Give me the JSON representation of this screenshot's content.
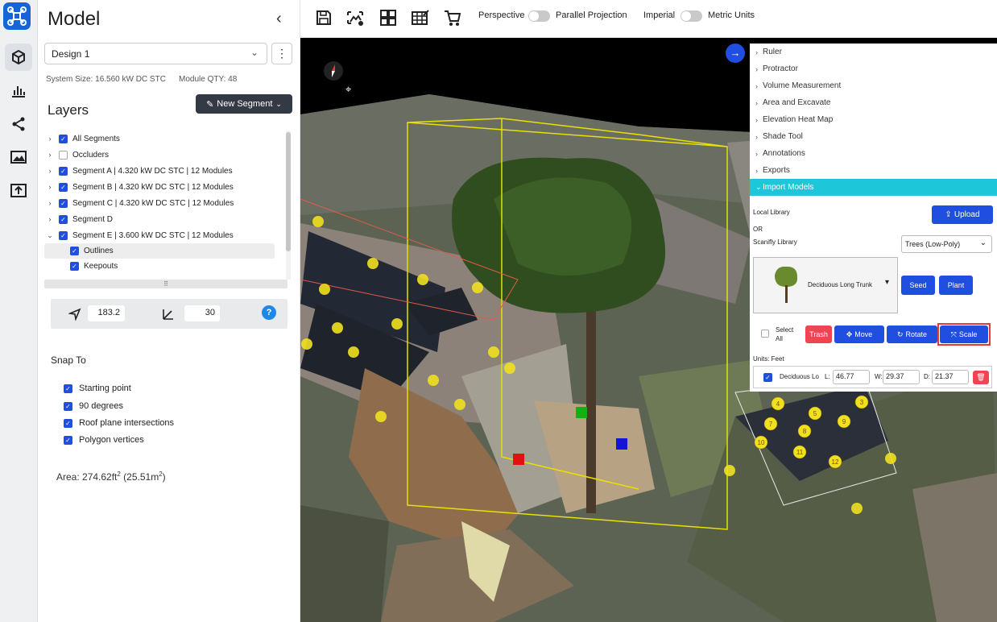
{
  "app": {
    "accent": "#1f4ee0",
    "cyan": "#1dc6d9",
    "danger": "#ef4451"
  },
  "rail": {
    "icons": [
      "logo-icon",
      "cube-icon",
      "chart-icon",
      "share-icon",
      "image-icon",
      "upload-icon"
    ]
  },
  "panel": {
    "title": "Model",
    "design_select": "Design 1",
    "system_size": "System Size: 16.560 kW DC STC",
    "module_qty": "Module QTY: 48",
    "layers_title": "Layers",
    "new_segment": "New Segment",
    "tree": [
      {
        "label": "All Segments",
        "checked": true,
        "arrow": "›"
      },
      {
        "label": "Occluders",
        "checked": false,
        "arrow": "›"
      },
      {
        "label": "Segment A | 4.320 kW DC STC | 12 Modules",
        "checked": true,
        "arrow": "›"
      },
      {
        "label": "Segment B | 4.320 kW DC STC | 12 Modules",
        "checked": true,
        "arrow": "›"
      },
      {
        "label": "Segment C | 4.320 kW DC STC | 12 Modules",
        "checked": true,
        "arrow": "›"
      },
      {
        "label": "Segment D",
        "checked": true,
        "arrow": "›"
      },
      {
        "label": "Segment E | 3.600 kW DC STC | 12 Modules",
        "checked": true,
        "arrow": "⌄"
      }
    ],
    "subitems": [
      {
        "label": "Outlines",
        "checked": true
      },
      {
        "label": "Keepouts",
        "checked": true
      }
    ],
    "azimuth": "183.2",
    "pitch": "30",
    "help": "?",
    "snap_title": "Snap To",
    "snap": [
      "Starting point",
      "90 degrees",
      "Roof plane intersections",
      "Polygon vertices"
    ],
    "area": {
      "prefix": "Area: 274.62ft",
      "sup1": "2",
      "mid": " (25.51m",
      "sup2": "2",
      "suffix": ")"
    }
  },
  "toolbar": {
    "icons": [
      "save-icon",
      "image-edit-icon",
      "grid-layout-icon",
      "table-edit-icon",
      "cart-icon"
    ],
    "perspective": "Perspective",
    "parallel": "Parallel Projection",
    "imperial": "Imperial",
    "metric": "Metric Units"
  },
  "tools": {
    "items": [
      "Ruler",
      "Protractor",
      "Volume Measurement",
      "Area and Excavate",
      "Elevation Heat Map",
      "Shade Tool",
      "Annotations",
      "Exports",
      "Import Models"
    ],
    "local_library": "Local Library",
    "upload": "Upload",
    "or": "OR",
    "scanifly_library": "Scanifly Library",
    "library_select": "Trees (Low-Poly)",
    "model_name": "Deciduous Long Trunk",
    "seed": "Seed",
    "plant": "Plant",
    "select_all": "Select All",
    "trash": "Trash",
    "move": "Move",
    "rotate": "Rotate",
    "scale": "Scale",
    "units": "Units: Feet",
    "item_name": "Deciduous Lo",
    "l_label": "L:",
    "l": "46.77",
    "w_label": "W:",
    "w": "29.37",
    "d_label": "D:",
    "d": "21.37"
  },
  "modules_visible": [
    "4",
    "5",
    "3",
    "7",
    "8",
    "9",
    "10",
    "11",
    "12"
  ]
}
